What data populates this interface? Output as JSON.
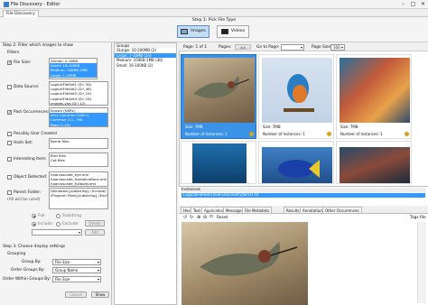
{
  "window": {
    "title": "File Discovery - Editor",
    "doc_tab": "File Discovery"
  },
  "step1": {
    "label": "Step 1: Pick File Type",
    "types": [
      {
        "label": "Images",
        "selected": true
      },
      {
        "label": "Videos",
        "selected": false
      }
    ]
  },
  "step2": {
    "label": "Step 2: Filter which images to show",
    "filters_label": "Filters",
    "file_size": {
      "label": "File Size:",
      "checked": true,
      "items": [
        {
          "t": "XSmall: 0-16KB",
          "s": false
        },
        {
          "t": "Small: 16-100KB",
          "s": true
        },
        {
          "t": "Medium: 100KB-1MB",
          "s": true
        },
        {
          "t": "Large: 1-10MB",
          "s": true
        }
      ]
    },
    "data_source": {
      "label": "Data Source:",
      "checked": false,
      "items": [
        "LogicalFileSet1 (D:\\ 30)",
        "LogicalFileSet2 (D:\\ 48)",
        "LogicalFileSet3 (D:\\ 24)",
        "LogicalFileSet4 (D:\\ 18)",
        "images.vhd (D:\\ 12)"
      ]
    },
    "past_occurrences": {
      "label": "Past Occurrences:",
      "checked": true,
      "items": [
        {
          "t": "Known (NSRL)",
          "s": false
        },
        {
          "t": "Very Common (100+)",
          "s": true
        },
        {
          "t": "Common (11 - 99)",
          "s": true
        },
        {
          "t": "Rare (1-10)",
          "s": true
        }
      ]
    },
    "possibly_user_created": {
      "label": "Possibly User Created",
      "checked": false
    },
    "hash_set": {
      "label": "Hash Set:",
      "checked": false,
      "items": [
        "Bomb files"
      ]
    },
    "interesting_item": {
      "label": "Interesting Item:",
      "checked": false,
      "items": [
        "Bird files",
        "Cat files"
      ]
    },
    "object_detected": {
      "label": "Object Detected:",
      "checked": false,
      "items": [
        "haarcascade_eye.xml",
        "haarcascade_frontalcatface.xml",
        "haarcascade_fullbody.xml"
      ]
    },
    "parent_folder": {
      "label": "Parent Folder:",
      "checked": false,
      "note": "(All will be used)",
      "items": [
        "\\Windows\\{substring} (Include)",
        "\\Program Files\\{substring} (Exclude)"
      ]
    },
    "full_label": "Full",
    "substring_label": "Substring",
    "include_label": "Include",
    "exclude_label": "Exclude",
    "delete_btn": "Delete",
    "add_btn": "Add"
  },
  "step3": {
    "label": "Step 3: Choose display settings",
    "grouping_label": "Grouping",
    "group_by": {
      "label": "Group By:",
      "value": "File Size"
    },
    "order_groups_by": {
      "label": "Order Groups By:",
      "value": "Group Name"
    },
    "order_within": {
      "label": "Order Within Groups By:",
      "value": "File Size"
    },
    "cancel_btn": "Cancel",
    "show_btn": "Show"
  },
  "groups": {
    "header": "Groups",
    "items": [
      {
        "t": "XLarge: 10-200MB (2)",
        "s": false
      },
      {
        "t": "Large: 1-10MB (24)",
        "s": true
      },
      {
        "t": "Medium: 100KB-1MB (30)",
        "s": false
      },
      {
        "t": "Small: 16-100KB (2)",
        "s": false
      }
    ]
  },
  "pager": {
    "page_label": "Page: 1 of 1",
    "pages_label": "Pages:",
    "goto_label": "Go to Page:",
    "size_label": "Page Size:",
    "size_value": "100"
  },
  "thumbnails": [
    {
      "size": "Size: 7MB",
      "instances": "Number of Instances: 1",
      "selected": true,
      "kind": "bird"
    },
    {
      "size": "Size: 7MB",
      "instances": "Number of Instances: 1",
      "selected": false,
      "kind": "kingfisher"
    },
    {
      "size": "Size: 7MB",
      "instances": "Number of Instances: 1",
      "selected": false,
      "kind": "reef"
    },
    {
      "size": "",
      "instances": "",
      "selected": false,
      "kind": "diver"
    },
    {
      "size": "",
      "instances": "",
      "selected": false,
      "kind": "fish"
    },
    {
      "size": "",
      "instances": "",
      "selected": false,
      "kind": "reef2"
    }
  ],
  "instances": {
    "header": "Instances",
    "path": "LogicalFileSet1\\File-Discovery\\bird1.tif"
  },
  "detail_tabs": [
    "Hex",
    "Text",
    "Application",
    "Message",
    "File Metadata",
    "Results",
    "Annotations",
    "Other Occurrences"
  ],
  "active_tab": "Application",
  "viewer": {
    "reset_label": "Reset",
    "tags_label": "Tags file"
  },
  "colors": {
    "accent": "#3399ff",
    "selected_thumb": "#3b93e8"
  }
}
